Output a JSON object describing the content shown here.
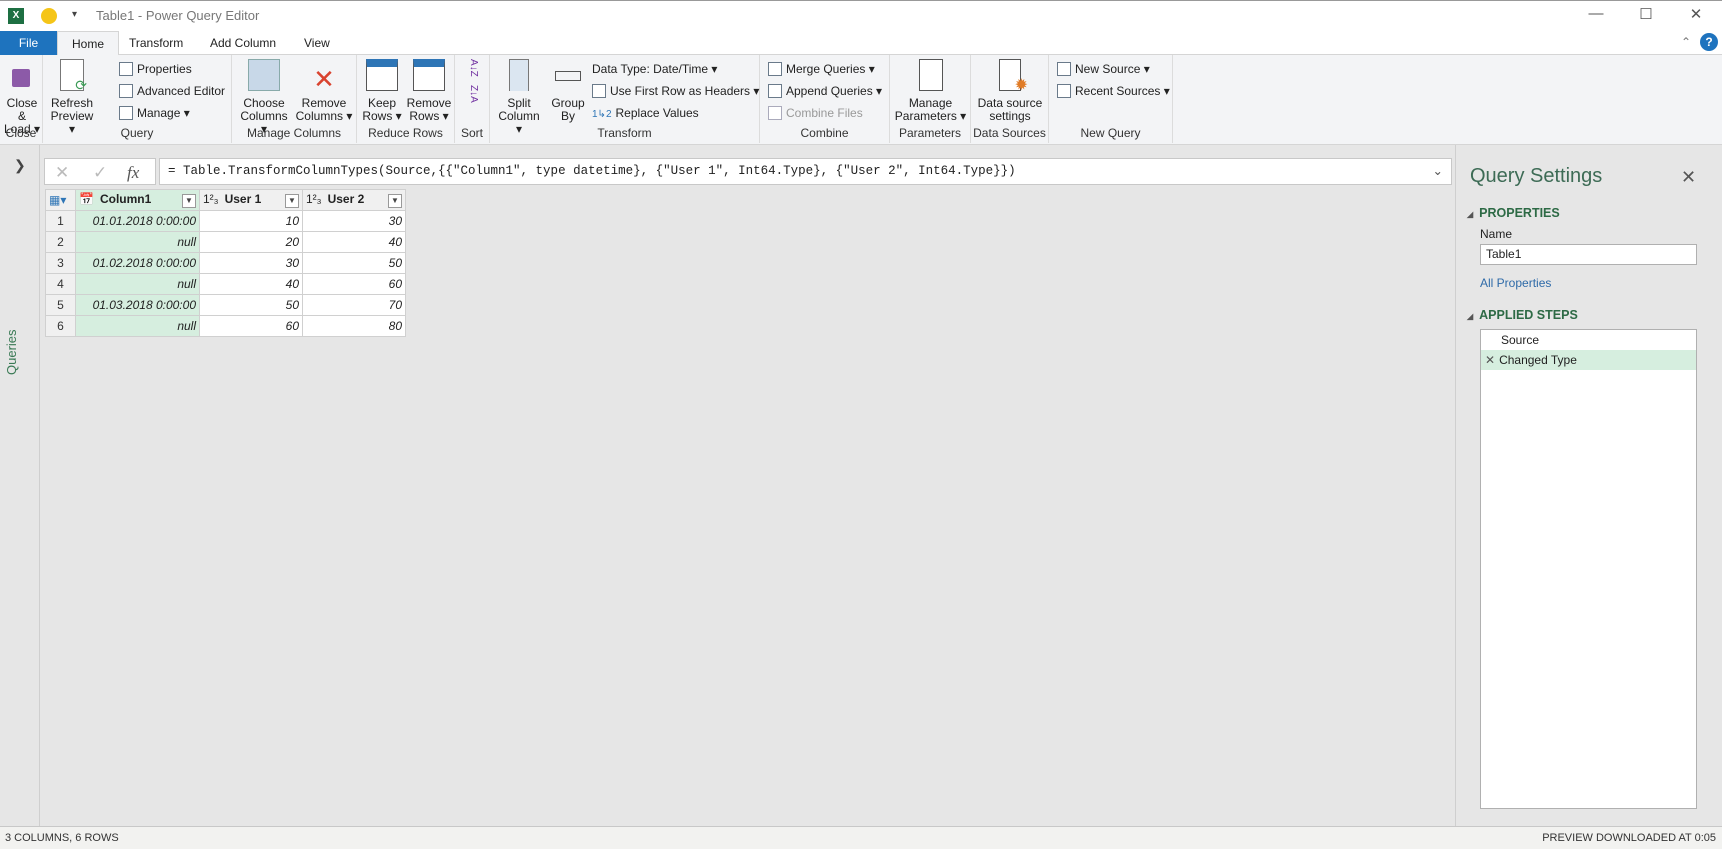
{
  "window": {
    "title": "Table1 - Power Query Editor",
    "minimize": "—",
    "maximize": "☐",
    "close": "✕"
  },
  "tabs": [
    {
      "label": "File"
    },
    {
      "label": "Home"
    },
    {
      "label": "Transform"
    },
    {
      "label": "Add Column"
    },
    {
      "label": "View"
    }
  ],
  "ribbon": {
    "close": {
      "group": "Close",
      "close_load": "Close &",
      "close_load2": "Load ▾"
    },
    "query": {
      "group": "Query",
      "refresh": "Refresh",
      "refresh2": "Preview ▾",
      "properties": "Properties",
      "advanced_editor": "Advanced Editor",
      "manage": "Manage ▾"
    },
    "manage_columns": {
      "group": "Manage Columns",
      "choose": "Choose",
      "choose2": "Columns ▾",
      "remove": "Remove",
      "remove2": "Columns ▾"
    },
    "reduce_rows": {
      "group": "Reduce Rows",
      "keep": "Keep",
      "keep2": "Rows ▾",
      "remove": "Remove",
      "remove2": "Rows ▾"
    },
    "sort": {
      "group": "Sort",
      "asc": "A↓Z",
      "desc": "Z↓A"
    },
    "transform": {
      "group": "Transform",
      "split": "Split",
      "split2": "Column ▾",
      "group_by": "Group",
      "group_by2": "By",
      "data_type": "Data Type: Date/Time ▾",
      "first_row": "Use First Row as Headers ▾",
      "replace": "Replace Values"
    },
    "combine": {
      "group": "Combine",
      "merge": "Merge Queries ▾",
      "append": "Append Queries ▾",
      "combine_files": "Combine Files"
    },
    "parameters": {
      "group": "Parameters",
      "manage": "Manage",
      "manage2": "Parameters ▾"
    },
    "data_sources": {
      "group": "Data Sources",
      "settings": "Data source",
      "settings2": "settings"
    },
    "new_query": {
      "group": "New Query",
      "new_source": "New Source ▾",
      "recent": "Recent Sources ▾"
    }
  },
  "queries_pane": {
    "label": "Queries"
  },
  "formula": {
    "text": "= Table.TransformColumnTypes(Source,{{\"Column1\", type datetime}, {\"User 1\", Int64.Type}, {\"User 2\", Int64.Type}})"
  },
  "grid": {
    "headers": [
      {
        "type": "📅",
        "label": "Column1"
      },
      {
        "type": "1²₃",
        "label": "User 1"
      },
      {
        "type": "1²₃",
        "label": "User 2"
      }
    ],
    "rows": [
      {
        "n": "1",
        "c1": "01.01.2018 0:00:00",
        "u1": "10",
        "u2": "30"
      },
      {
        "n": "2",
        "c1": "null",
        "u1": "20",
        "u2": "40"
      },
      {
        "n": "3",
        "c1": "01.02.2018 0:00:00",
        "u1": "30",
        "u2": "50"
      },
      {
        "n": "4",
        "c1": "null",
        "u1": "40",
        "u2": "60"
      },
      {
        "n": "5",
        "c1": "01.03.2018 0:00:00",
        "u1": "50",
        "u2": "70"
      },
      {
        "n": "6",
        "c1": "null",
        "u1": "60",
        "u2": "80"
      }
    ]
  },
  "settings": {
    "title": "Query Settings",
    "properties": "PROPERTIES",
    "name_label": "Name",
    "name_value": "Table1",
    "all_properties": "All Properties",
    "applied_steps": "APPLIED STEPS",
    "steps": [
      "Source",
      "Changed Type"
    ]
  },
  "status": {
    "left": "3 COLUMNS, 6 ROWS",
    "right": "PREVIEW DOWNLOADED AT 0:05"
  }
}
